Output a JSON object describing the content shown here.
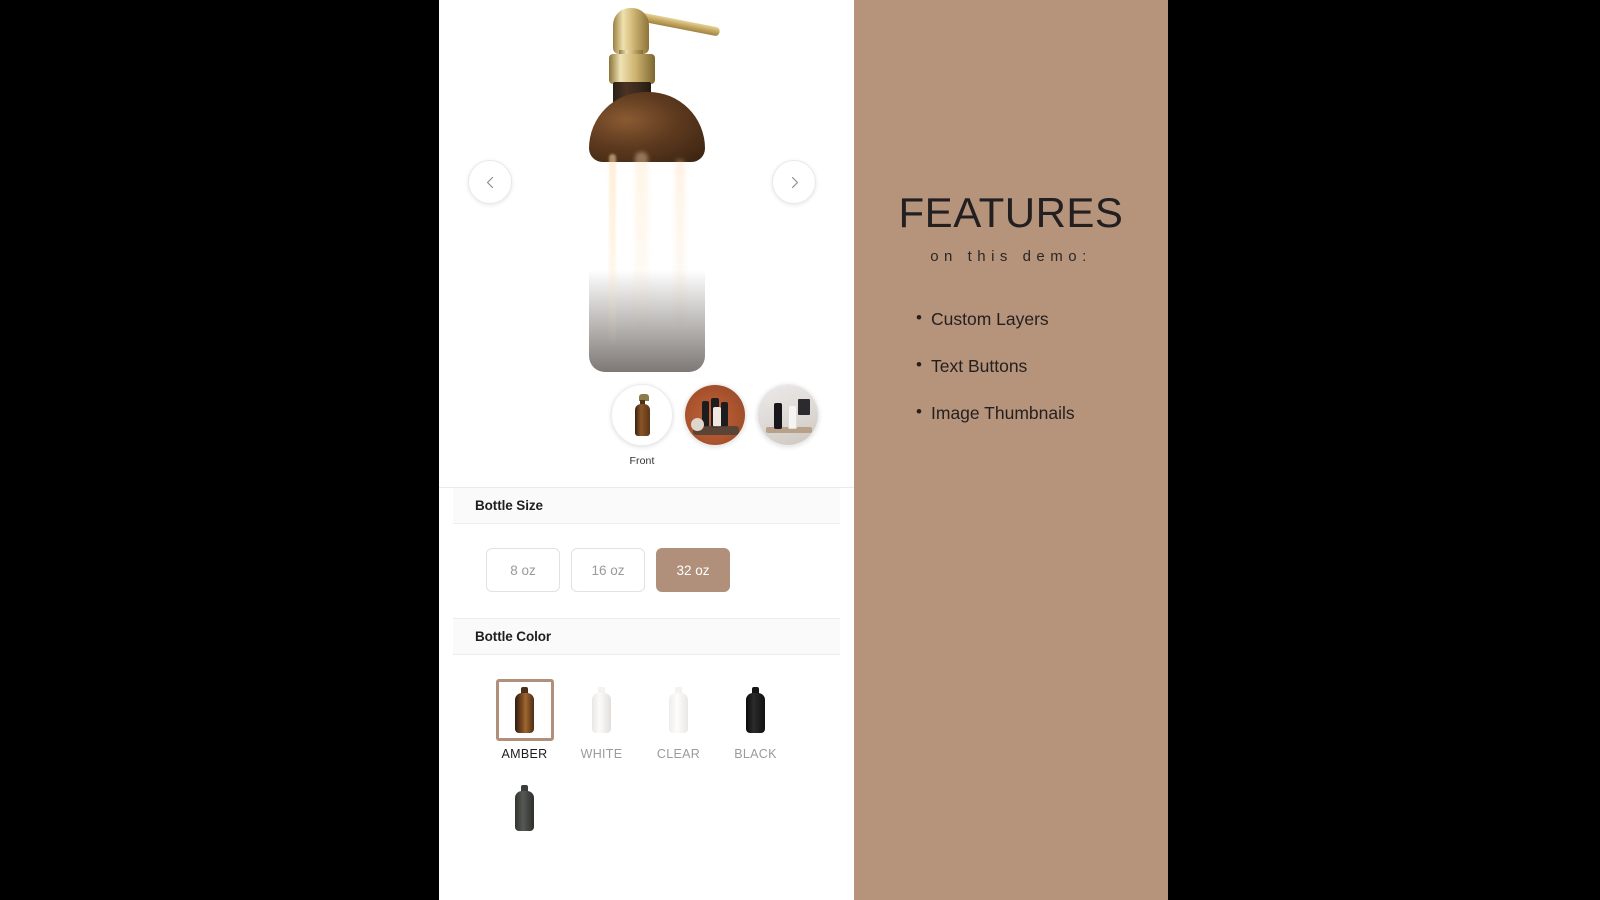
{
  "gallery": {
    "prev_label": "Previous image",
    "next_label": "Next image",
    "hero_alt": "Amber glass pump bottle",
    "thumbnails": [
      {
        "label": "Front",
        "kind": "product",
        "selected": true
      },
      {
        "label": "",
        "kind": "lifestyle-orange",
        "selected": false
      },
      {
        "label": "",
        "kind": "lifestyle-shelf",
        "selected": false
      }
    ]
  },
  "options": [
    {
      "id": "bottle-size",
      "title": "Bottle Size",
      "type": "text-buttons",
      "choices": [
        {
          "label": "8 oz",
          "selected": false
        },
        {
          "label": "16 oz",
          "selected": false
        },
        {
          "label": "32 oz",
          "selected": true
        }
      ]
    },
    {
      "id": "bottle-color",
      "title": "Bottle Color",
      "type": "image-swatches",
      "choices": [
        {
          "label": "AMBER",
          "swatch": "amber",
          "selected": true
        },
        {
          "label": "WHITE",
          "swatch": "white",
          "selected": false
        },
        {
          "label": "CLEAR",
          "swatch": "clear",
          "selected": false
        },
        {
          "label": "BLACK",
          "swatch": "black",
          "selected": false
        },
        {
          "label": "",
          "swatch": "gray",
          "selected": false
        }
      ]
    }
  ],
  "features_panel": {
    "title": "FEATURES",
    "subtitle": "on this demo:",
    "items": [
      "Custom Layers",
      "Text Buttons",
      "Image Thumbnails"
    ]
  },
  "colors": {
    "accent": "#b0907a",
    "panel_background": "#b5947b",
    "section_header_background": "#fafafa",
    "canvas": "#ffffff",
    "letterbox": "#000000"
  }
}
